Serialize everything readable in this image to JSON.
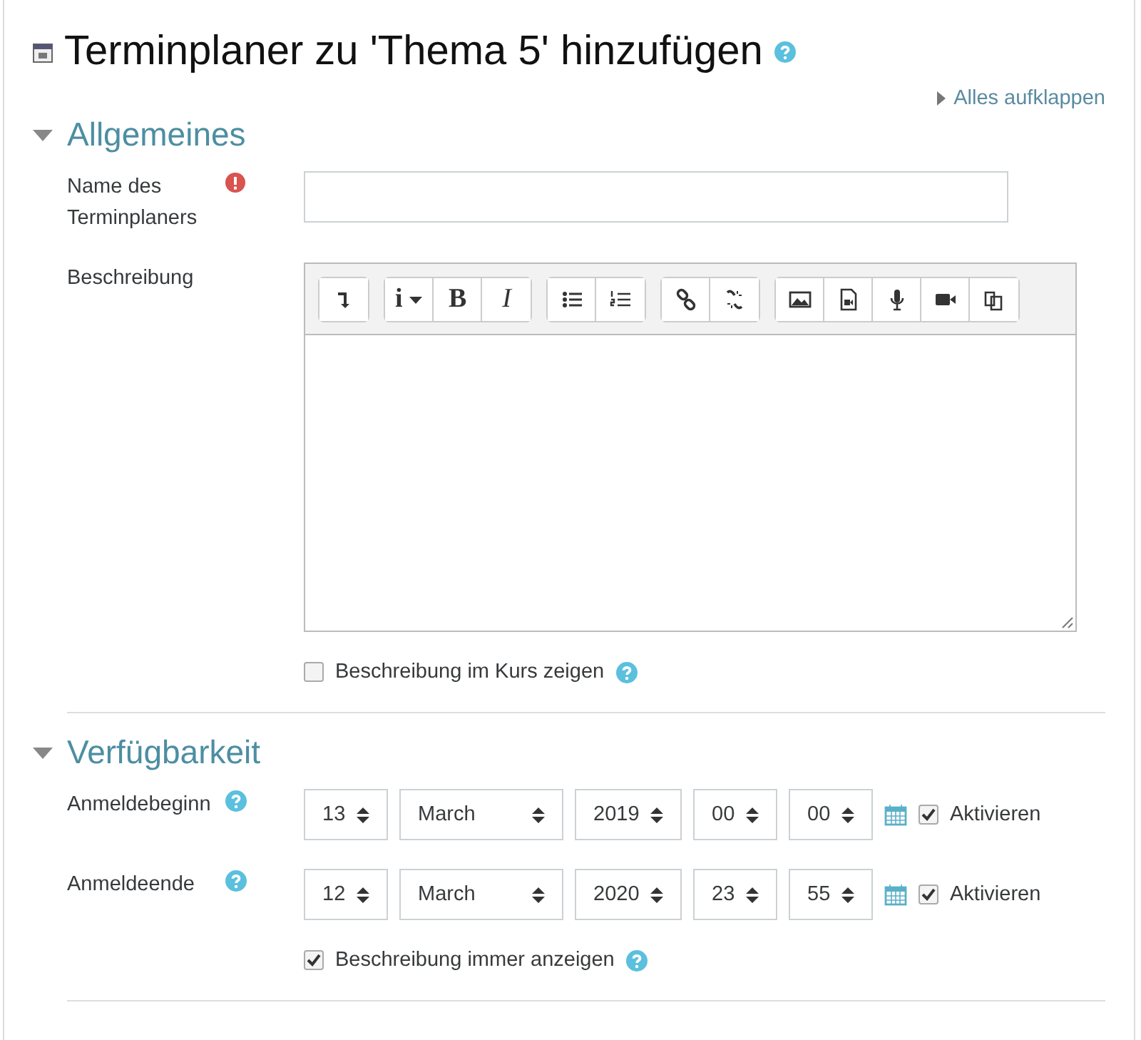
{
  "page": {
    "title": "Terminplaner zu 'Thema 5' hinzufügen"
  },
  "expand_all": "Alles aufklappen",
  "sections": [
    {
      "title": "Allgemeines",
      "expanded": true,
      "fields": [
        {
          "kind": "text",
          "label": "Name des Terminplaners",
          "required": true
        },
        {
          "kind": "editor",
          "label": "Beschreibung",
          "toolbar": [
            [
              {
                "kind": "collapse"
              }
            ],
            [
              {
                "kind": "styles",
                "label": "i"
              },
              {
                "kind": "bold",
                "label": "B"
              },
              {
                "kind": "italic",
                "label": "I"
              }
            ],
            [
              {
                "kind": "bullets"
              },
              {
                "kind": "numbers"
              }
            ],
            [
              {
                "kind": "link"
              },
              {
                "kind": "unlink"
              }
            ],
            [
              {
                "kind": "image"
              },
              {
                "kind": "media"
              },
              {
                "kind": "audio"
              },
              {
                "kind": "video"
              },
              {
                "kind": "paste"
              }
            ]
          ]
        },
        {
          "kind": "checkbox",
          "label": "Beschreibung im Kurs zeigen",
          "checked": false,
          "help": true
        }
      ]
    },
    {
      "title": "Verfügbarkeit",
      "expanded": true,
      "fields": [
        {
          "kind": "datetime",
          "label": "Anmeldebeginn",
          "help": true,
          "selects": [
            "13",
            "March",
            "2019",
            "00",
            "00"
          ],
          "enable_label": "Aktivieren",
          "enabled": true
        },
        {
          "kind": "datetime",
          "label": "Anmeldeende",
          "help": true,
          "selects": [
            "12",
            "March",
            "2020",
            "23",
            "55"
          ],
          "enable_label": "Aktivieren",
          "enabled": true
        },
        {
          "kind": "checkbox",
          "label": "Beschreibung immer anzeigen",
          "checked": true,
          "help": true
        }
      ]
    }
  ]
}
